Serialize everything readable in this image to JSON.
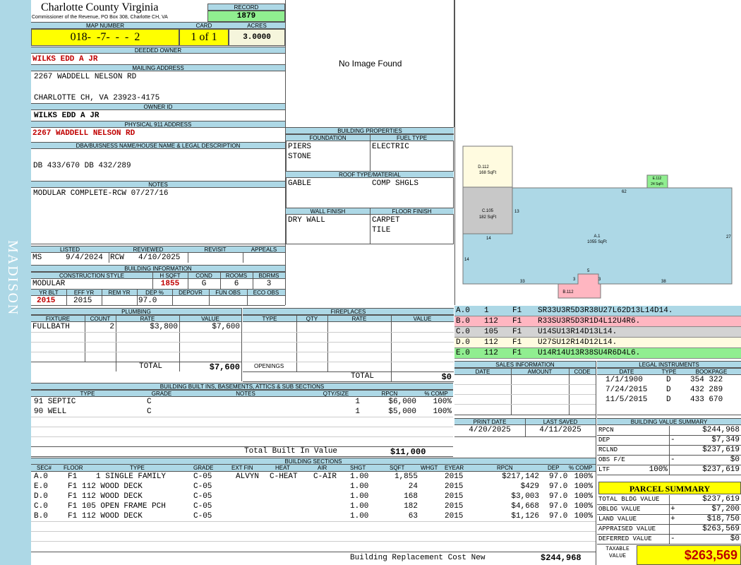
{
  "sidebar": {
    "district": "MADISON"
  },
  "header": {
    "county": "Charlotte County Virginia",
    "commissioner": "Commissioner of the Revenue, PO Box 308, Charlotte CH, VA",
    "record_label": "RECORD",
    "record": "1879",
    "map_label": "MAP NUMBER",
    "map_number": "018-  -7-  -  -  2",
    "card_label": "CARD",
    "card": "1 of 1",
    "acres_label": "ACRES",
    "acres": "3.0000"
  },
  "owner": {
    "deeded_label": "DEEDED OWNER",
    "deeded_owner": "WILKS EDD A JR",
    "mailing_label": "MAILING ADDRESS",
    "mailing_line1": "2267 WADDELL NELSON RD",
    "mailing_line2": "CHARLOTTE CH, VA 23923-4175",
    "owner_id_label": "OWNER ID",
    "owner_id": "WILKS EDD A JR",
    "physical_label": "PHYSICAL 911 ADDRESS",
    "physical_address": "2267 WADDELL NELSON RD",
    "dba_label": "DBA/BUISNESS NAME/HOUSE NAME & LEGAL DESCRIPTION",
    "legal_description": "DB 433/670 DB 432/289",
    "notes_label": "NOTES",
    "notes": "MODULAR COMPLETE-RCW 07/27/16"
  },
  "photo": {
    "placeholder": "No Image Found"
  },
  "review": {
    "headers": [
      "LISTED",
      "REVIEWED",
      "REVISIT",
      "APPEALS"
    ],
    "listed_by": "MS",
    "listed_date": "9/4/2024",
    "reviewed_by": "RCW",
    "reviewed_date": "4/10/2025",
    "revisit": "",
    "appeals": ""
  },
  "building_info": {
    "title": "BUILDING INFORMATION",
    "headers1": [
      "CONSTRUCTION STYLE",
      "H SQFT",
      "COND",
      "ROOMS",
      "BDRMS"
    ],
    "construction_style": "MODULAR",
    "hsqft": "1855",
    "cond": "G",
    "rooms": "6",
    "bdrms": "3",
    "headers2": [
      "YR BLT",
      "EFF YR",
      "REM YR",
      "DEP %",
      "DEPOVR",
      "FUN OBS",
      "ECO OBS"
    ],
    "yr_blt": "2015",
    "eff_yr": "2015",
    "rem_yr": "",
    "dep_pct": "97.0",
    "depovr": "",
    "fun_obs": "",
    "eco_obs": ""
  },
  "building_properties": {
    "title": "BUILDING PROPERTIES",
    "foundation_label": "FOUNDATION",
    "foundation": [
      "PIERS",
      "STONE"
    ],
    "fuel_label": "FUEL TYPE",
    "fuel": [
      "ELECTRIC"
    ],
    "roof_label": "ROOF TYPE/MATERIAL",
    "roof": [
      "GABLE",
      "COMP SHGLS"
    ],
    "wall_label": "WALL FINISH",
    "wall": [
      "DRY WALL"
    ],
    "floor_label": "FLOOR FINISH",
    "floor": [
      "CARPET",
      "TILE"
    ]
  },
  "sketch": {
    "labels": [
      {
        "id": "D.112",
        "sqft": "168 SqFt"
      },
      {
        "id": "E.112",
        "sqft": "24 SqFt"
      },
      {
        "id": "C.105",
        "sqft": "182 SqFt"
      },
      {
        "id": "A.1",
        "sqft": "1055 SqFt"
      },
      {
        "id": "B.112",
        "sqft": ""
      }
    ],
    "dims": [
      "62",
      "13",
      "27",
      "14",
      "14",
      "33",
      "3",
      "5",
      "3",
      "38"
    ],
    "colors": {
      "A": "#add8e6",
      "B": "#ffb6c1",
      "C": "#c8c8c8",
      "D": "#fffbe0",
      "E": "#90ee90"
    }
  },
  "sketch_codes": [
    {
      "sec": "A.0",
      "num": "1",
      "floor": "F1",
      "code": "SR33U3R5D3R38U27L62D13L14D14.",
      "color": "#add8e6"
    },
    {
      "sec": "B.0",
      "num": "112",
      "floor": "F1",
      "code": "R33SU3R5D3R1D4L12U4R6.",
      "color": "#ffb6c1"
    },
    {
      "sec": "C.0",
      "num": "105",
      "floor": "F1",
      "code": "U14SU13R14D13L14.",
      "color": "#d3d3d3"
    },
    {
      "sec": "D.0",
      "num": "112",
      "floor": "F1",
      "code": "U27SU12R14D12L14.",
      "color": "#fffbe0"
    },
    {
      "sec": "E.0",
      "num": "112",
      "floor": "F1",
      "code": "U14R14U13R38SU4R6D4L6.",
      "color": "#90ee90"
    }
  ],
  "plumbing": {
    "title": "PLUMBING",
    "headers": [
      "FIXTURE",
      "COUNT",
      "RATE",
      "VALUE"
    ],
    "rows": [
      {
        "fixture": "FULLBATH",
        "count": "2",
        "rate": "$3,800",
        "value": "$7,600"
      }
    ],
    "total_label": "TOTAL",
    "total": "$7,600"
  },
  "fireplaces": {
    "title": "FIREPLACES",
    "headers": [
      "TYPE",
      "QTY",
      "RATE",
      "VALUE"
    ],
    "openings_label": "OPENINGS",
    "total_label": "TOTAL",
    "total": "$0"
  },
  "built_ins": {
    "title": "BUILDING BUILT INS, BASEMENTS, ATTICS & SUB SECTIONS",
    "headers": [
      "TYPE",
      "GRADE",
      "NOTES",
      "QTY/SIZE",
      "RPCN",
      "% COMP"
    ],
    "rows": [
      {
        "type": "91 SEPTIC",
        "grade": "C",
        "notes": "",
        "qty": "1",
        "rpcn": "$6,000",
        "comp": "100%"
      },
      {
        "type": "90 WELL",
        "grade": "C",
        "notes": "",
        "qty": "1",
        "rpcn": "$5,000",
        "comp": "100%"
      }
    ],
    "total_label": "Total Built In Value",
    "total": "$11,000"
  },
  "sales": {
    "title": "SALES INFORMATION",
    "headers": [
      "DATE",
      "AMOUNT",
      "CODE"
    ]
  },
  "legal": {
    "title": "LEGAL INSTRUMENTS",
    "headers": [
      "DATE",
      "TYPE",
      "BOOKPAGE"
    ],
    "rows": [
      {
        "date": "1/1/1900",
        "type": "D",
        "book": "354 322"
      },
      {
        "date": "7/24/2015",
        "type": "D",
        "book": "432 289"
      },
      {
        "date": "11/5/2015",
        "type": "D",
        "book": "433 670"
      }
    ]
  },
  "print_info": {
    "print_label": "PRINT DATE",
    "print_date": "4/20/2025",
    "saved_label": "LAST SAVED",
    "last_saved": "4/11/2025"
  },
  "value_summary": {
    "title": "BUILDING VALUE SUMMARY",
    "rows": [
      {
        "label": "RPCN",
        "sign": "",
        "value": "$244,968"
      },
      {
        "label": "DEP",
        "sign": "-",
        "value": "$7,349"
      },
      {
        "label": "RCLND",
        "sign": "",
        "value": "$237,619"
      },
      {
        "label": "OBS F/E",
        "sign": "-",
        "value": "$0"
      },
      {
        "label": "LTF",
        "pct": "100%",
        "sign": "",
        "value": "$237,619"
      }
    ]
  },
  "parcel_summary": {
    "title": "PARCEL SUMMARY",
    "rows": [
      {
        "label": "TOTAL BLDG VALUE",
        "sign": "",
        "value": "$237,619"
      },
      {
        "label": "OBLDG VALUE",
        "sign": "+",
        "value": "$7,200"
      },
      {
        "label": "LAND VALUE",
        "sign": "+",
        "value": "$18,750"
      },
      {
        "label": "APPRAISED VALUE",
        "sign": "",
        "value": "$263,569"
      },
      {
        "label": "DEFERRED VALUE",
        "sign": "-",
        "value": "$0"
      }
    ],
    "taxable_label": "TAXABLE VALUE",
    "taxable_value": "$263,569"
  },
  "sections": {
    "title": "BUILDING SECTIONS",
    "headers": [
      "SEC#",
      "FLOOR",
      "TYPE",
      "GRADE",
      "EXT FIN",
      "HEAT",
      "AIR",
      "SHGT",
      "SQFT",
      "WHGT",
      "EYEAR",
      "RPCN",
      "DEP",
      "% COMP"
    ],
    "rows": [
      {
        "sec": "A.0",
        "floor": "F1",
        "type": "1 SINGLE FAMILY",
        "grade": "C-05",
        "ext": "ALVYN",
        "heat": "C-HEAT",
        "air": "C-AIR",
        "shgt": "1.00",
        "sqft": "1,855",
        "whgt": "",
        "eyear": "2015",
        "rpcn": "$217,142",
        "dep": "97.0",
        "comp": "100%"
      },
      {
        "sec": "E.0",
        "floor": "F1",
        "type": "112 WOOD DECK",
        "grade": "C-05",
        "ext": "",
        "heat": "",
        "air": "",
        "shgt": "1.00",
        "sqft": "24",
        "whgt": "",
        "eyear": "2015",
        "rpcn": "$429",
        "dep": "97.0",
        "comp": "100%"
      },
      {
        "sec": "D.0",
        "floor": "F1",
        "type": "112 WOOD DECK",
        "grade": "C-05",
        "ext": "",
        "heat": "",
        "air": "",
        "shgt": "1.00",
        "sqft": "168",
        "whgt": "",
        "eyear": "2015",
        "rpcn": "$3,003",
        "dep": "97.0",
        "comp": "100%"
      },
      {
        "sec": "C.0",
        "floor": "F1",
        "type": "105 OPEN FRAME PCH",
        "grade": "C-05",
        "ext": "",
        "heat": "",
        "air": "",
        "shgt": "1.00",
        "sqft": "182",
        "whgt": "",
        "eyear": "2015",
        "rpcn": "$4,668",
        "dep": "97.0",
        "comp": "100%"
      },
      {
        "sec": "B.0",
        "floor": "F1",
        "type": "112 WOOD DECK",
        "grade": "C-05",
        "ext": "",
        "heat": "",
        "air": "",
        "shgt": "1.00",
        "sqft": "63",
        "whgt": "",
        "eyear": "2015",
        "rpcn": "$1,126",
        "dep": "97.0",
        "comp": "100%"
      }
    ],
    "total_label": "Building Replacement Cost New",
    "total": "$244,968"
  }
}
